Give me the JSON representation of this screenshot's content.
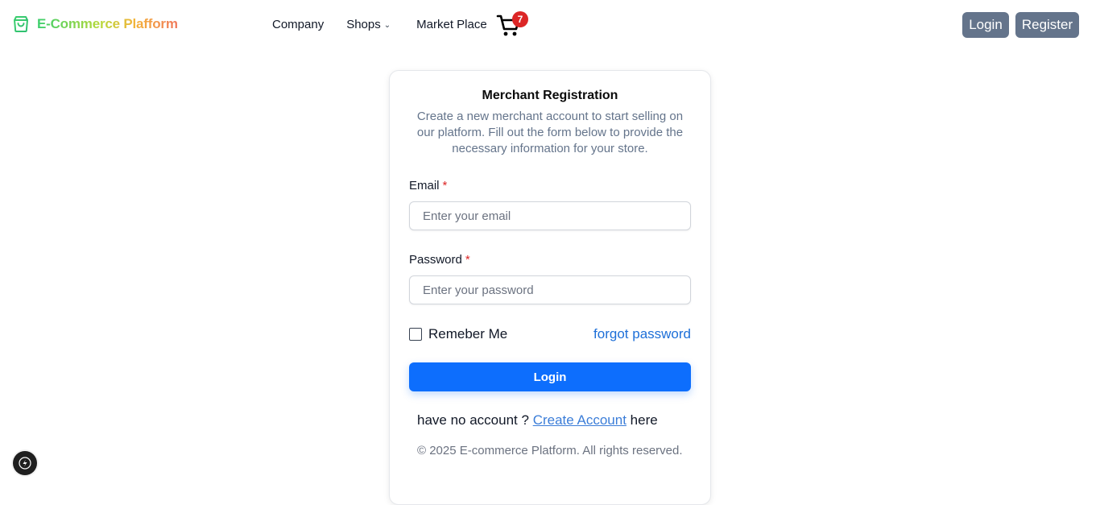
{
  "header": {
    "brand": "E-Commerce Plafform",
    "brand_icon": "shopping-bag-icon",
    "nav": {
      "company": "Company",
      "shops": "Shops",
      "marketplace": "Market Place"
    },
    "cart_icon": "cart-icon",
    "cart_count": "7",
    "login_label": "Login",
    "register_label": "Register"
  },
  "card": {
    "title": "Merchant Registration",
    "description": "Create a new merchant account to start selling on our platform. Fill out the form below to provide the necessary information for your store.",
    "email_label": "Email",
    "email_placeholder": "Enter your email",
    "email_value": "",
    "password_label": "Password",
    "password_placeholder": "Enter your password",
    "password_value": "",
    "required_mark": "*",
    "remember_label": "Remeber Me",
    "forgot_label": "forgot password",
    "submit_label": "Login",
    "no_account_prefix": "have no account ?",
    "create_account_link": "Create Account",
    "no_account_suffix": "here",
    "copyright": "© 2025 E-commerce Platform. All rights reserved."
  },
  "colors": {
    "primary": "#0d6efd",
    "header_button": "#64748b",
    "badge": "#dc2626",
    "required": "#dc2626",
    "link": "#1d6fd8"
  },
  "floating_button_icon": "bolt-icon"
}
